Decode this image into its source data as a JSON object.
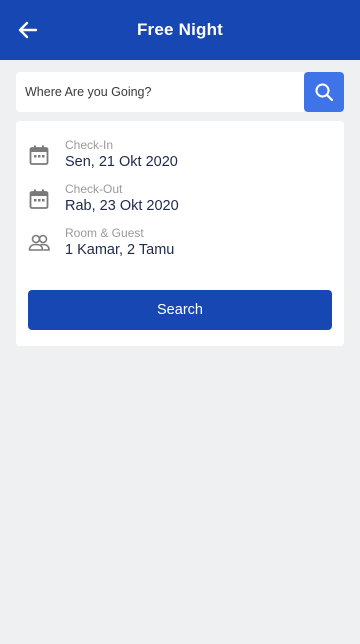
{
  "header": {
    "title": "Free Night",
    "back_icon": "arrow-left-icon",
    "background": "#1747b3"
  },
  "search": {
    "placeholder": "Where Are you Going?",
    "value": "",
    "button_icon": "search-icon",
    "button_color": "#3f73e8"
  },
  "booking": {
    "check_in": {
      "label": "Check-In",
      "value": "Sen, 21 Okt 2020",
      "icon": "calendar-icon"
    },
    "check_out": {
      "label": "Check-Out",
      "value": "Rab, 23 Okt 2020",
      "icon": "calendar-icon"
    },
    "room_guest": {
      "label": "Room & Guest",
      "value": "1 Kamar, 2 Tamu",
      "icon": "people-icon"
    },
    "search_button_label": "Search"
  }
}
